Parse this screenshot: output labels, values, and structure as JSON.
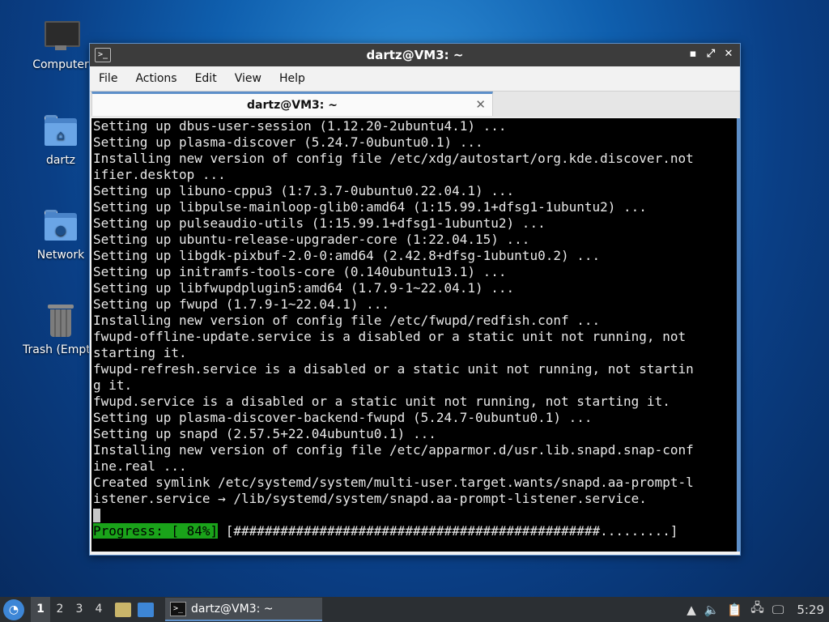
{
  "desktop": {
    "icons": [
      {
        "label": "Computer"
      },
      {
        "label": "dartz"
      },
      {
        "label": "Network"
      },
      {
        "label": "Trash (Empty)"
      }
    ]
  },
  "window": {
    "title": "dartz@VM3: ~",
    "controls": {
      "minimize": "▪",
      "maximize": "⤢",
      "close": "✕"
    },
    "menu": [
      "File",
      "Actions",
      "Edit",
      "View",
      "Help"
    ],
    "tab": {
      "label": "dartz@VM3: ~",
      "close": "✕"
    }
  },
  "terminal": {
    "lines": [
      "Setting up dbus-user-session (1.12.20-2ubuntu4.1) ...",
      "Setting up plasma-discover (5.24.7-0ubuntu0.1) ...",
      "Installing new version of config file /etc/xdg/autostart/org.kde.discover.not",
      "ifier.desktop ...",
      "Setting up libuno-cppu3 (1:7.3.7-0ubuntu0.22.04.1) ...",
      "Setting up libpulse-mainloop-glib0:amd64 (1:15.99.1+dfsg1-1ubuntu2) ...",
      "Setting up pulseaudio-utils (1:15.99.1+dfsg1-1ubuntu2) ...",
      "Setting up ubuntu-release-upgrader-core (1:22.04.15) ...",
      "Setting up libgdk-pixbuf-2.0-0:amd64 (2.42.8+dfsg-1ubuntu0.2) ...",
      "Setting up initramfs-tools-core (0.140ubuntu13.1) ...",
      "Setting up libfwupdplugin5:amd64 (1.7.9-1~22.04.1) ...",
      "Setting up fwupd (1.7.9-1~22.04.1) ...",
      "Installing new version of config file /etc/fwupd/redfish.conf ...",
      "fwupd-offline-update.service is a disabled or a static unit not running, not",
      "starting it.",
      "fwupd-refresh.service is a disabled or a static unit not running, not startin",
      "g it.",
      "fwupd.service is a disabled or a static unit not running, not starting it.",
      "Setting up plasma-discover-backend-fwupd (5.24.7-0ubuntu0.1) ...",
      "Setting up snapd (2.57.5+22.04ubuntu0.1) ...",
      "Installing new version of config file /etc/apparmor.d/usr.lib.snapd.snap-conf",
      "ine.real ...",
      "Created symlink /etc/systemd/system/multi-user.target.wants/snapd.aa-prompt-l",
      "istener.service → /lib/systemd/system/snapd.aa-prompt-listener.service."
    ],
    "progress_label": "Progress: [ 84%]",
    "progress_bar": " [###############################################.........]",
    "progress_percent": 84
  },
  "taskbar": {
    "workspaces": [
      "1",
      "2",
      "3",
      "4"
    ],
    "active_workspace": "1",
    "task_label": "dartz@VM3: ~",
    "clock": "5:29"
  }
}
